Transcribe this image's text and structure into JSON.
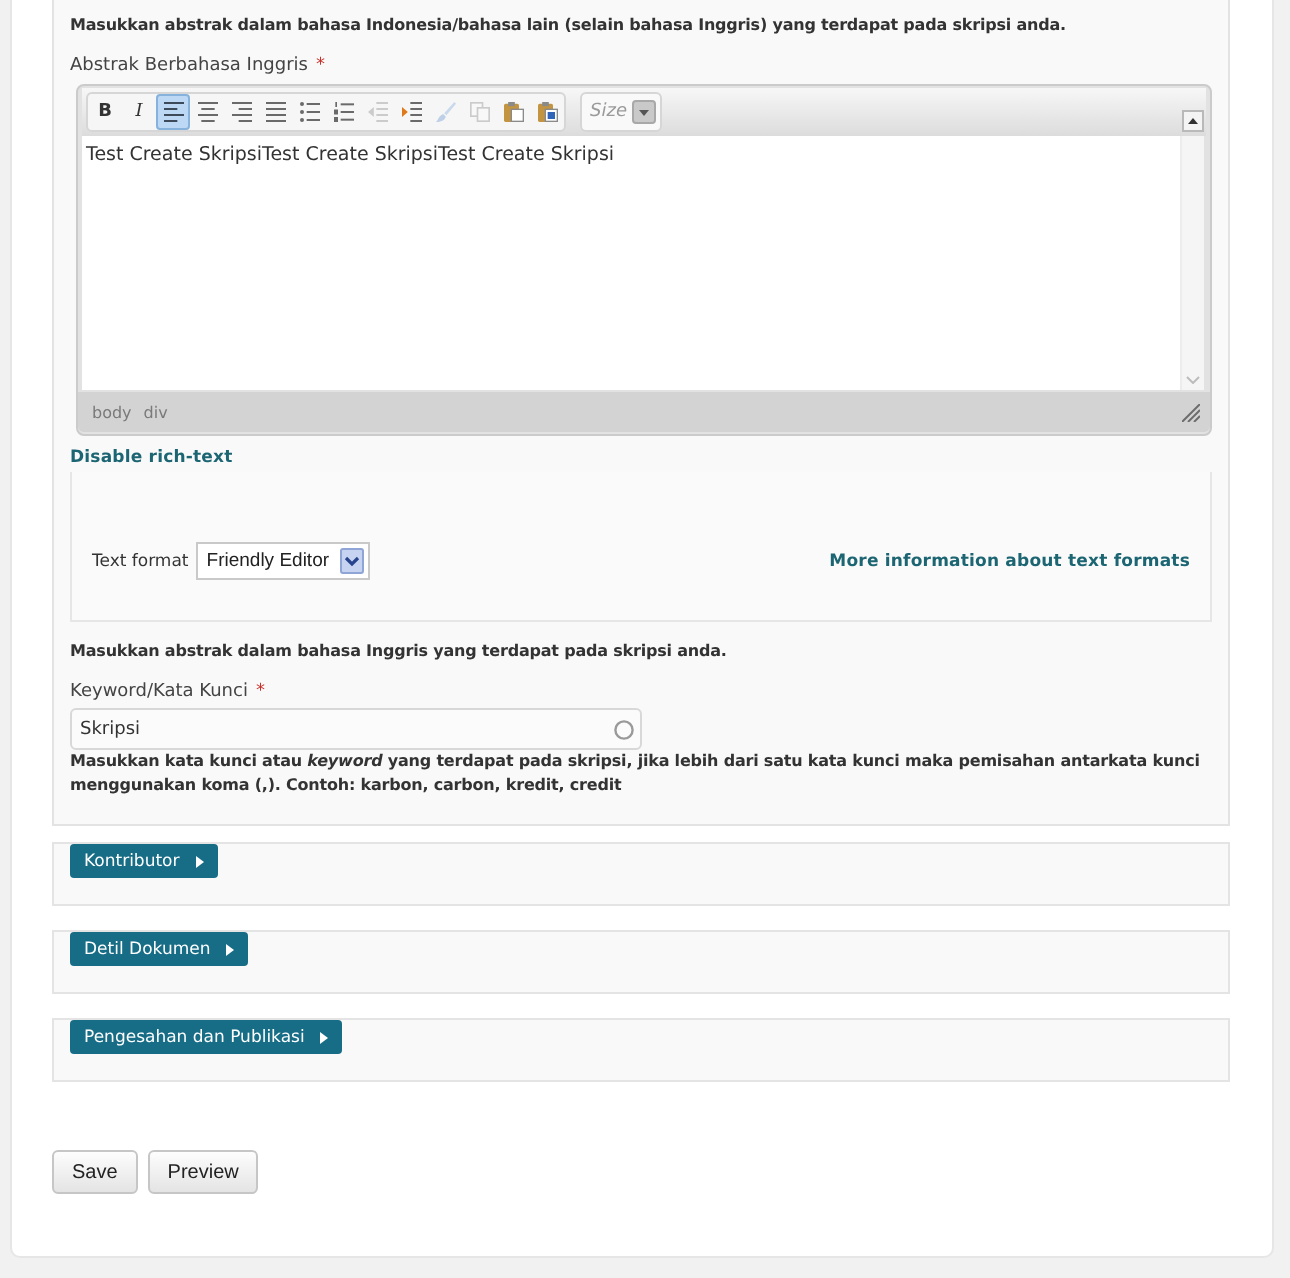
{
  "top_help": "Masukkan abstrak dalam bahasa Indonesia/bahasa lain (selain bahasa Inggris) yang terdapat pada skripsi anda.",
  "abstract_field": {
    "label": "Abstrak Berbahasa Inggris",
    "required_mark": "*",
    "editor": {
      "toolbar": [
        {
          "kind": "bold",
          "label": "B",
          "selected": false,
          "disabled": false
        },
        {
          "kind": "italic",
          "label": "I",
          "selected": false,
          "disabled": false
        },
        {
          "kind": "alignleft",
          "selected": true,
          "disabled": false
        },
        {
          "kind": "aligncenter",
          "selected": false,
          "disabled": false
        },
        {
          "kind": "alignright",
          "selected": false,
          "disabled": false
        },
        {
          "kind": "justify",
          "selected": false,
          "disabled": false
        },
        {
          "kind": "bullets",
          "selected": false,
          "disabled": false
        },
        {
          "kind": "numbers",
          "selected": false,
          "disabled": false
        },
        {
          "kind": "outdent",
          "selected": false,
          "disabled": true
        },
        {
          "kind": "indent",
          "selected": false,
          "disabled": false
        },
        {
          "kind": "brush",
          "selected": false,
          "disabled": true
        },
        {
          "kind": "copy",
          "selected": false,
          "disabled": true
        },
        {
          "kind": "paste",
          "selected": false,
          "disabled": false
        },
        {
          "kind": "pasteword",
          "selected": false,
          "disabled": false
        }
      ],
      "size_select": {
        "placeholder": "Size"
      },
      "content": "Test Create SkripsiTest Create SkripsiTest Create Skripsi",
      "status_path": [
        "body",
        "div"
      ]
    },
    "rich_text_link": "Disable rich-text",
    "text_format": {
      "label": "Text format",
      "value": "Friendly Editor",
      "help_link": "More information about text formats"
    },
    "help": "Masukkan abstrak dalam bahasa Inggris yang terdapat pada skripsi anda."
  },
  "keyword_field": {
    "label": "Keyword/Kata Kunci",
    "required_mark": "*",
    "value": "Skripsi",
    "help": "Masukkan kata kunci atau *keyword* yang terdapat pada skripsi, jika lebih dari satu kata kunci maka pemisahan antarkata kunci menggunakan koma (,). Contoh: karbon, carbon, kredit, credit"
  },
  "sections": [
    {
      "label": "Kontributor",
      "expanded": false
    },
    {
      "label": "Detil Dokumen",
      "expanded": false
    },
    {
      "label": "Pengesahan dan Publikasi",
      "expanded": false
    }
  ],
  "buttons": [
    {
      "label": "Save"
    },
    {
      "label": "Preview"
    }
  ]
}
